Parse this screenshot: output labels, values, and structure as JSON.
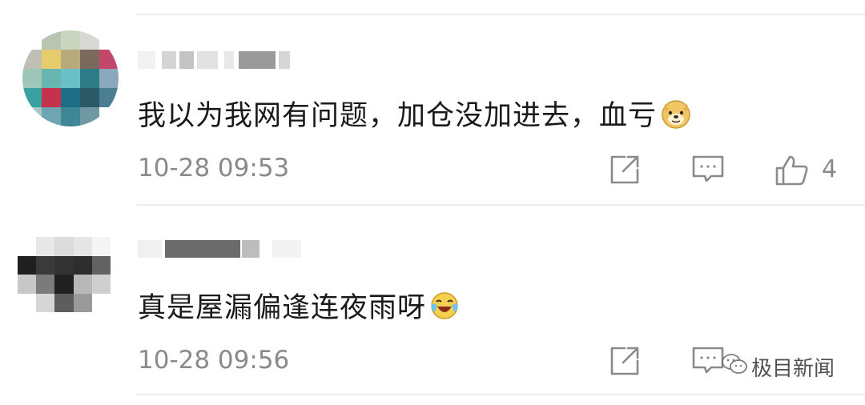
{
  "comments": [
    {
      "text": "我以为我网有问题，加仓没加进去，血亏",
      "emoji": "doge-emoji",
      "time": "10-28 09:53",
      "likes": "4"
    },
    {
      "text": "真是屋漏偏逢连夜雨呀",
      "emoji": "laugh-cry-emoji",
      "time": "10-28 09:56",
      "likes": ""
    }
  ],
  "watermark": {
    "label": "极目新闻",
    "icon": "wechat-icon"
  },
  "icons": {
    "share": "share-icon",
    "reply": "comment-icon",
    "like": "thumbs-up-icon"
  }
}
